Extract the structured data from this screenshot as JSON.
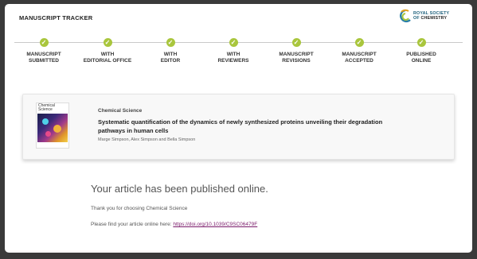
{
  "header": {
    "title": "MANUSCRIPT TRACKER"
  },
  "logo": {
    "line1": "ROYAL SOCIETY",
    "line2": "OF",
    "line3": "CHEMISTRY"
  },
  "tracker": {
    "steps": [
      {
        "label1": "MANUSCRIPT",
        "label2": "SUBMITTED",
        "status": "complete"
      },
      {
        "label1": "WITH",
        "label2": "EDITORIAL OFFICE",
        "status": "complete"
      },
      {
        "label1": "WITH",
        "label2": "EDITOR",
        "status": "complete"
      },
      {
        "label1": "WITH",
        "label2": "REVIEWERS",
        "status": "complete"
      },
      {
        "label1": "MANUSCRIPT",
        "label2": "REVISIONS",
        "status": "complete"
      },
      {
        "label1": "MANUSCRIPT",
        "label2": "ACCEPTED",
        "status": "complete"
      },
      {
        "label1": "PUBLISHED",
        "label2": "ONLINE",
        "status": "complete"
      }
    ],
    "check_color": "#a9c63d"
  },
  "article": {
    "cover_title_1": "Chemical",
    "cover_title_2": "Science",
    "journal": "Chemical Science",
    "title": "Systematic quantification of the dynamics of newly synthesized proteins unveiling their degradation pathways in human cells",
    "authors": "Marge Simpson, Alex Simpson and Bella Simpson"
  },
  "message": {
    "heading": "Your article has been published online.",
    "thanks": "Thank you for choosing Chemical Science",
    "find_prefix": "Please find your article online here: ",
    "link": "https://doi.org/10.1039/C9SC06479F"
  }
}
